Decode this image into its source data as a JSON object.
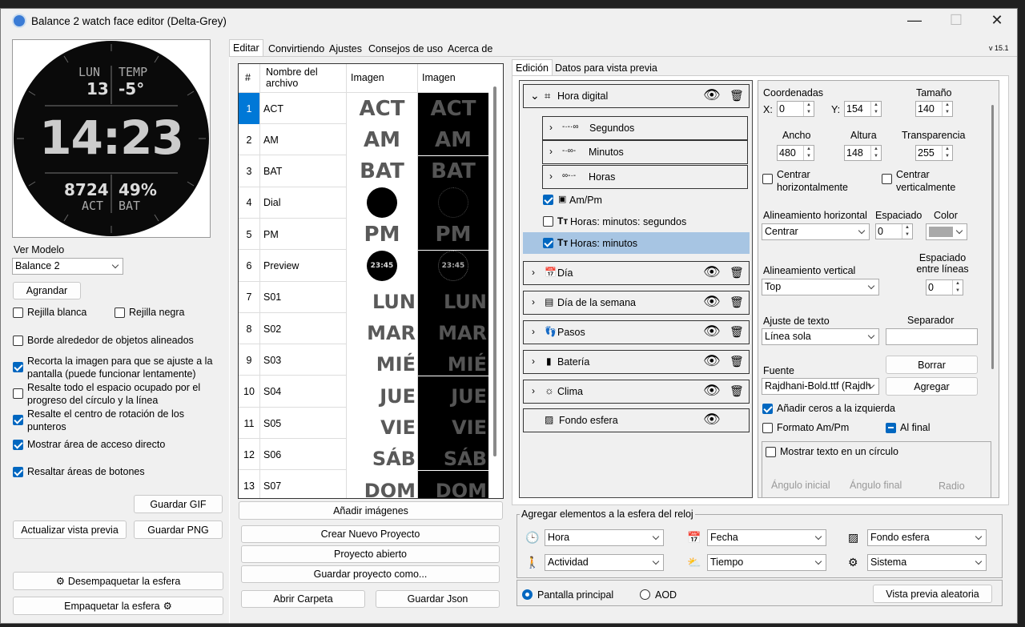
{
  "window": {
    "title": "Balance 2 watch face editor (Delta-Grey)",
    "minimize": "—",
    "maximize": "☐",
    "close": "✕"
  },
  "version": "v 15.1",
  "watch": {
    "top_left_label": "LUN",
    "top_left_value": "13",
    "top_right_label": "TEMP",
    "top_right_value": "-5°",
    "time": "14:23",
    "bottom_left_value": "8724",
    "bottom_left_label": "ACT",
    "bottom_right_value": "49%",
    "bottom_right_label": "BAT"
  },
  "left": {
    "model_label": "Ver Modelo",
    "model_value": "Balance 2",
    "enlarge": "Agrandar",
    "white_grid": "Rejilla blanca",
    "black_grid": "Rejilla negra",
    "border_aligned": "Borde alrededor de objetos alineados",
    "crop_image": "Recorta la imagen para que se ajuste a la pantalla (puede funcionar lentamente)",
    "highlight_space": "Resalte todo el espacio ocupado por el progreso del círculo y la línea",
    "highlight_center": "Resalte el centro de rotación de los punteros",
    "show_shortcut": "Mostrar área de acceso directo",
    "highlight_buttons": "Resaltar áreas de botones",
    "save_gif": "Guardar GIF",
    "update_preview": "Actualizar vista previa",
    "save_png": "Guardar PNG",
    "unpack": "Desempaquetar la esfera",
    "pack": "Empaquetar la esfera"
  },
  "main_tabs": [
    "Editar",
    "Convirtiendo",
    "Ajustes",
    "Consejos de uso",
    "Acerca de"
  ],
  "grid": {
    "headers": [
      "#",
      "Nombre del archivo",
      "Imagen",
      "Imagen"
    ],
    "rows": [
      {
        "n": "1",
        "name": "ACT",
        "img": "ACT"
      },
      {
        "n": "2",
        "name": "AM",
        "img": "AM"
      },
      {
        "n": "3",
        "name": "BAT",
        "img": "BAT"
      },
      {
        "n": "4",
        "name": "Dial",
        "img": ""
      },
      {
        "n": "5",
        "name": "PM",
        "img": "PM"
      },
      {
        "n": "6",
        "name": "Preview",
        "img": "23:45"
      },
      {
        "n": "7",
        "name": "S01",
        "img": "LUN"
      },
      {
        "n": "8",
        "name": "S02",
        "img": "MAR"
      },
      {
        "n": "9",
        "name": "S03",
        "img": "MIÉ"
      },
      {
        "n": "10",
        "name": "S04",
        "img": "JUE"
      },
      {
        "n": "11",
        "name": "S05",
        "img": "VIE"
      },
      {
        "n": "12",
        "name": "S06",
        "img": "SÁB"
      },
      {
        "n": "13",
        "name": "S07",
        "img": "DOM"
      }
    ]
  },
  "middle_buttons": {
    "add_images": "Añadir imágenes",
    "new_project": "Crear Nuevo Proyecto",
    "open_project": "Proyecto abierto",
    "save_as": "Guardar proyecto como...",
    "open_folder": "Abrir Carpeta",
    "save_json": "Guardar Json"
  },
  "edit_tabs": [
    "Edición",
    "Datos para vista previa"
  ],
  "tree": {
    "hora_digital": "Hora digital",
    "segundos": "Segundos",
    "minutos": "Minutos",
    "horas": "Horas",
    "ampm": "Am/Pm",
    "hms": "Horas: minutos: segundos",
    "hm": "Horas: minutos",
    "dia": "Día",
    "dia_semana": "Día de la semana",
    "pasos": "Pasos",
    "bateria": "Batería",
    "clima": "Clima",
    "fondo": "Fondo esfera"
  },
  "props": {
    "coords": "Coordenadas",
    "x_label": "X:",
    "x": "0",
    "y_label": "Y:",
    "y": "154",
    "size_label": "Tamaño",
    "size": "140",
    "width_label": "Ancho",
    "width": "480",
    "height_label": "Altura",
    "height": "148",
    "transp_label": "Transparencia",
    "transp": "255",
    "center_h": "Centrar horizontalmente",
    "center_v": "Centrar verticalmente",
    "align_h_label": "Alineamiento horizontal",
    "align_h": "Centrar",
    "spacing_label": "Espaciado",
    "spacing": "0",
    "color_label": "Color",
    "align_v_label": "Alineamiento vertical",
    "align_v": "Top",
    "line_spacing_label": "Espaciado entre líneas",
    "line_spacing": "0",
    "text_fit_label": "Ajuste de texto",
    "text_fit": "Línea sola",
    "separator_label": "Separador",
    "delete": "Borrar",
    "font_label": "Fuente",
    "font": "Rajdhani-Bold.ttf (Rajdh",
    "add": "Agregar",
    "leading_zeros": "Añadir ceros a la izquierda",
    "ampm_format": "Formato Am/Pm",
    "at_end": "Al final",
    "circle_text": "Mostrar texto en un círculo",
    "start_angle": "Ángulo inicial",
    "end_angle": "Ángulo final",
    "radius": "Radio"
  },
  "add_elements": {
    "title": "Agregar elementos a la esfera del reloj",
    "hora": "Hora",
    "fecha": "Fecha",
    "fondo": "Fondo esfera",
    "actividad": "Actividad",
    "tiempo": "Tiempo",
    "sistema": "Sistema"
  },
  "bottom": {
    "main_screen": "Pantalla principal",
    "aod": "AOD",
    "random_preview": "Vista previa aleatoria"
  }
}
